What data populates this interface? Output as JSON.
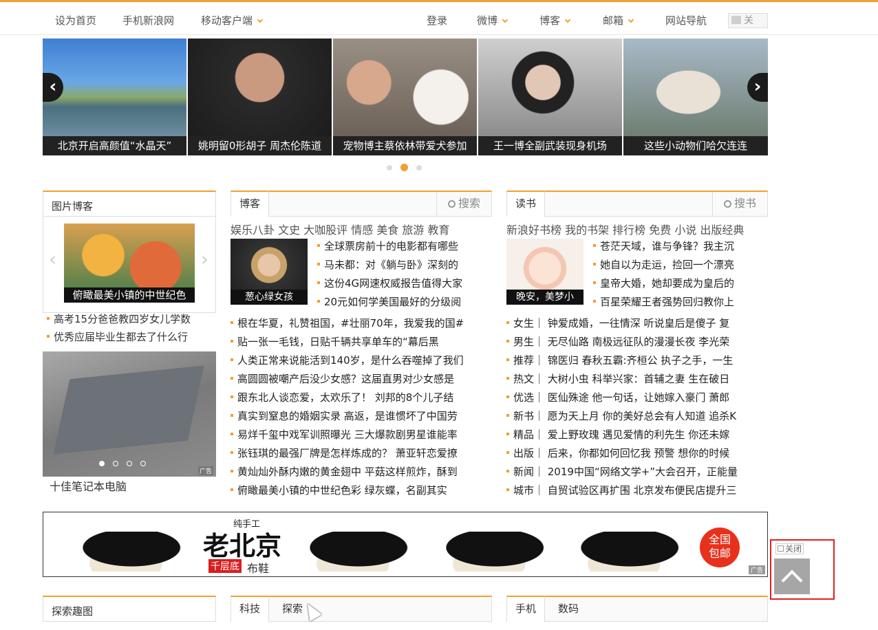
{
  "topbar": {
    "set_home": "设为首页",
    "mobile_sina": "手机新浪网",
    "mobile_client": "移动客户端",
    "login": "登录",
    "weibo": "微博",
    "blog": "博客",
    "mail": "邮箱",
    "site_nav": "网站导航",
    "close": "关"
  },
  "slider": {
    "captions": [
      "北京开启高颜值“水晶天”",
      "姚明留0形胡子 周杰伦陈道",
      "宠物博主蔡依林带爱犬参加",
      "王一博全副武装现身机场",
      "这些小动物们哈欠连连"
    ],
    "prev": "‹",
    "next": "›"
  },
  "photo_blog": {
    "title": "图片博客",
    "image_caption": "俯瞰最美小镇的中世纪色",
    "links": [
      "高考15分爸爸教四岁女儿学数",
      "优秀应届毕业生都去了什么行"
    ],
    "ad_caption": "十佳笔记本电脑",
    "ad_tag": "广告"
  },
  "blog_box": {
    "tab": "博客",
    "search": "搜索",
    "categories": "娱乐八卦 文史 大咖股评 情感 美食 旅游 教育",
    "thumb_caption": "葱心绿女孩",
    "top_links": [
      "全球票房前十的电影都有哪些",
      "马未都：对《躺与卧》深刻的",
      "这份4G网速权威报告值得大家",
      "20元如何学美国最好的分级阅"
    ],
    "links": [
      "根在华夏，礼赞祖国，#壮丽70年，我爱我的国#",
      "贴一张一毛钱，日贴千辆共享单车的“幕后黑",
      "人类正常来说能活到140岁，是什么吞噬掉了我们",
      "高圆圆被嘲产后没少女感？这届直男对少女感是",
      "跟东北人谈恋爱，太欢乐了！ 刘邦的8个儿子结",
      "真实到窒息的婚姻实录 高返，是谁惯坏了中国劳",
      "易烊千玺中戏军训照曝光 三大爆款剧男星谁能率",
      "张钰琪的最强厂牌是怎样炼成的？ 萧亚轩恋爱撩",
      "黄灿灿外酥内嫩的黄金翅中 平菇这样煎炸，酥到",
      "俯瞰最美小镇的中世纪色彩 绿灰蝶，名副其实"
    ]
  },
  "book_box": {
    "tab": "读书",
    "search": "搜书",
    "categories": "新浪好书榜 我的书架 排行榜 免费 小说 出版经典",
    "thumb_caption": "晚安，美梦小",
    "top_links": [
      "苍茫天域，谁与争锋？我主沉",
      "她自以为走运，捡回一个漂亮",
      "皇帝大婚，她却要成为皇后的",
      "百星荣耀王者强势回归教你上"
    ],
    "links": [
      "女生｜ 钟爱成婚，一往情深 听说皇后是傻子 复",
      "男生｜ 无尽仙路 南极远征队的漫漫长夜 李光荣",
      "推荐｜ 锦医归 春秋五霸:齐桓公 执子之手，一生",
      "热文｜ 大树小虫 科举兴家：首辅之妻 生在破日",
      "优选｜ 医仙殊途 他一句话，让她嫁入豪门 萧郎",
      "新书｜ 愿为天上月 你的美好总会有人知道 追杀K",
      "精品｜ 爱上野玫瑰 遇见爱情的利先生 你还未嫁",
      "出版｜ 后来，你都如何回忆我 预警 想你的时候",
      "新闻｜ 2019中国“网络文学+”大会召开，正能量",
      "城市｜ 自贸试验区再扩围 北京发布便民店提升三"
    ]
  },
  "ad_banner": {
    "small": "纯手工",
    "brand": "老北京",
    "tag": "千层底",
    "suffix": "布鞋",
    "promo": "全国包邮",
    "ad": "广告"
  },
  "backtop": {
    "close": "关闭"
  },
  "bottom": {
    "explore_title": "探索趣图",
    "mid_tabs": [
      "科技",
      "探索"
    ],
    "right_tabs": [
      "手机",
      "数码"
    ]
  }
}
